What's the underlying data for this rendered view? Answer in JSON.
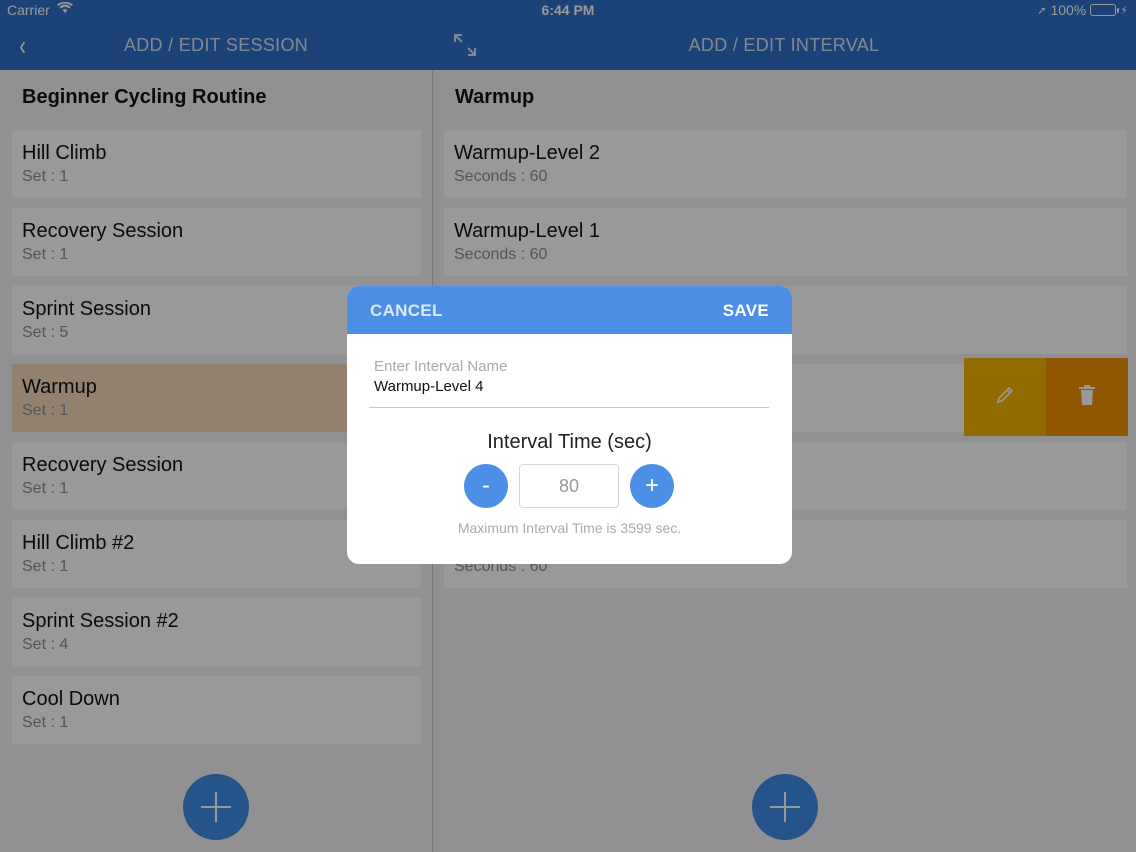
{
  "status_bar": {
    "carrier": "Carrier",
    "time": "6:44 PM",
    "battery": "100%"
  },
  "nav": {
    "left_title": "ADD / EDIT SESSION",
    "right_title": "ADD / EDIT INTERVAL"
  },
  "session_pane": {
    "title": "Beginner Cycling Routine",
    "items": [
      {
        "name": "Hill Climb",
        "sub": "Set : 1"
      },
      {
        "name": "Recovery Session",
        "sub": "Set : 1"
      },
      {
        "name": "Sprint Session",
        "sub": "Set : 5"
      },
      {
        "name": "Warmup",
        "sub": "Set : 1",
        "selected": true
      },
      {
        "name": "Recovery Session",
        "sub": "Set : 1"
      },
      {
        "name": "Hill Climb #2",
        "sub": "Set : 1"
      },
      {
        "name": "Sprint Session #2",
        "sub": "Set : 4"
      },
      {
        "name": "Cool Down",
        "sub": "Set : 1"
      }
    ]
  },
  "interval_pane": {
    "title": "Warmup",
    "items": [
      {
        "name": "Warmup-Level 2",
        "sub": "Seconds : 60"
      },
      {
        "name": "Warmup-Level 1",
        "sub": "Seconds : 60"
      },
      {
        "name": "",
        "sub": ""
      },
      {
        "name": "",
        "sub": ""
      },
      {
        "name": "",
        "sub": ""
      },
      {
        "name": "",
        "sub": "Seconds : 60"
      }
    ]
  },
  "modal": {
    "cancel": "CANCEL",
    "save": "SAVE",
    "name_placeholder": "Enter Interval Name",
    "name_value": "Warmup-Level 4",
    "interval_title": "Interval Time (sec)",
    "minus": "-",
    "plus": "+",
    "time_value": "80",
    "note": "Maximum Interval Time is 3599 sec."
  },
  "colors": {
    "nav": "#2f71c6",
    "accent": "#4b8fe6",
    "edit": "#f0b400",
    "delete": "#f29000",
    "selected": "#f6d8b6"
  }
}
